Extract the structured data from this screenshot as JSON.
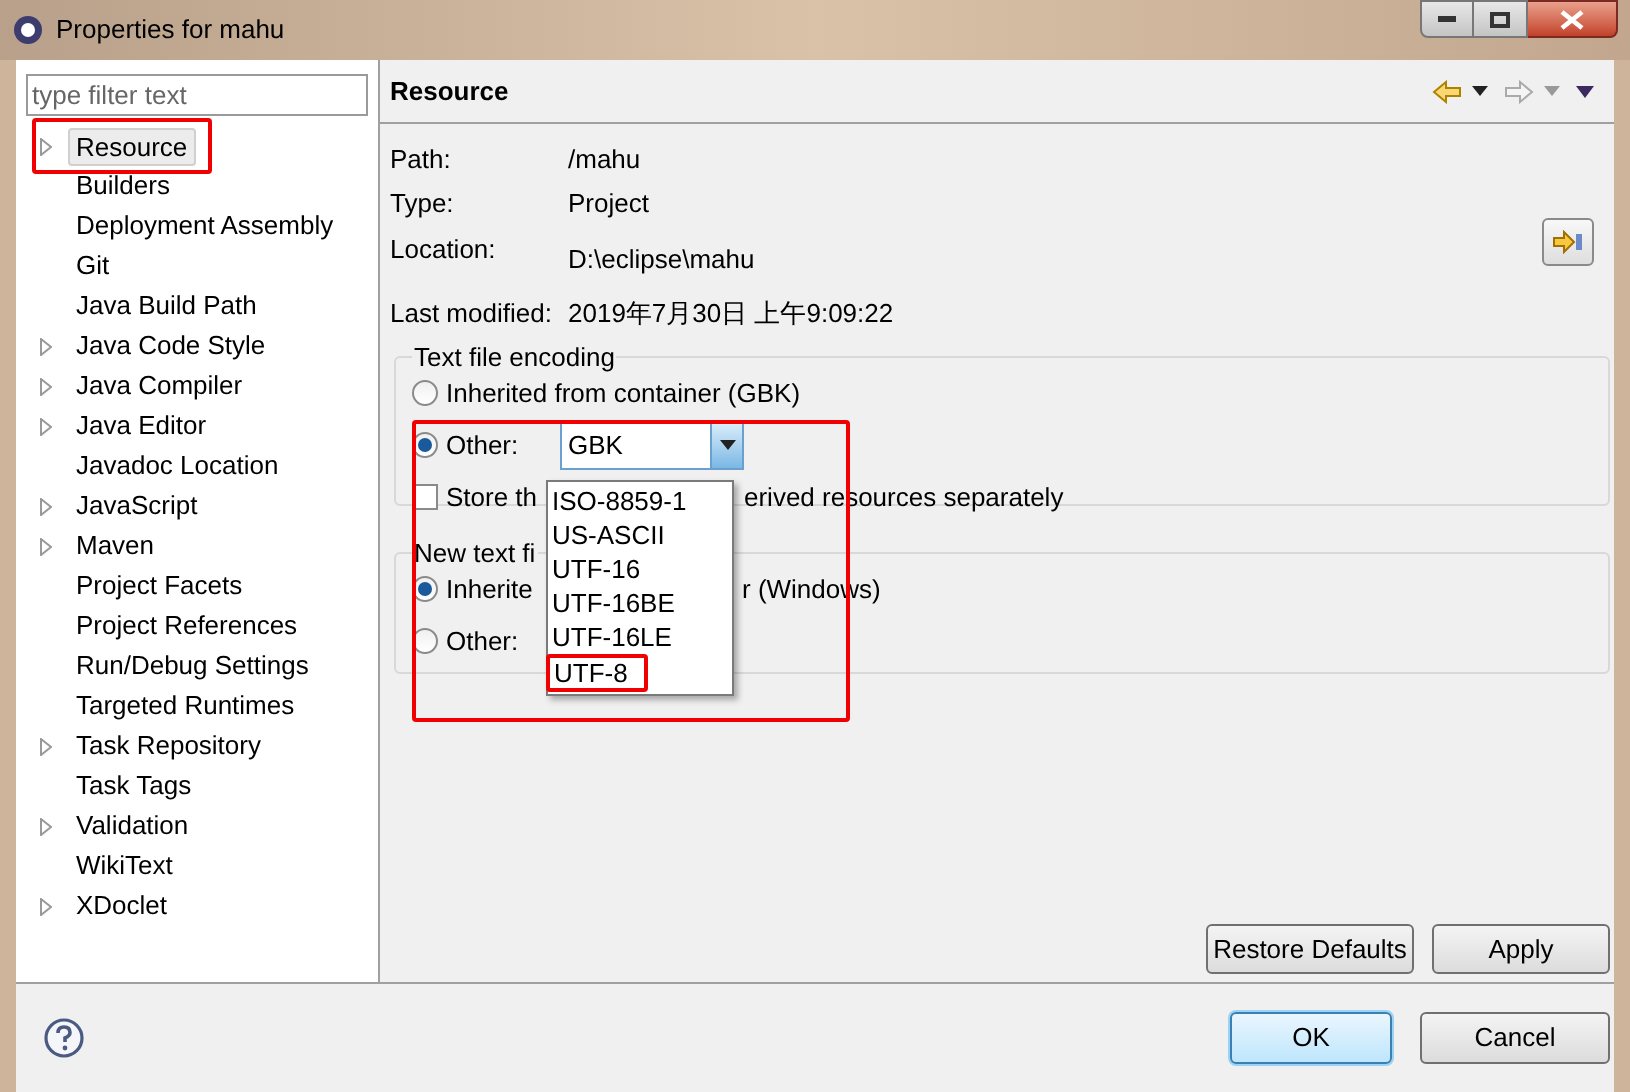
{
  "window": {
    "title": "Properties for mahu"
  },
  "filter": {
    "placeholder": "type filter text"
  },
  "tree": [
    {
      "label": "Resource",
      "expandable": true,
      "selected": true
    },
    {
      "label": "Builders",
      "expandable": false,
      "selected": false
    },
    {
      "label": "Deployment Assembly",
      "expandable": false,
      "selected": false
    },
    {
      "label": "Git",
      "expandable": false,
      "selected": false
    },
    {
      "label": "Java Build Path",
      "expandable": false,
      "selected": false
    },
    {
      "label": "Java Code Style",
      "expandable": true,
      "selected": false
    },
    {
      "label": "Java Compiler",
      "expandable": true,
      "selected": false
    },
    {
      "label": "Java Editor",
      "expandable": true,
      "selected": false
    },
    {
      "label": "Javadoc Location",
      "expandable": false,
      "selected": false
    },
    {
      "label": "JavaScript",
      "expandable": true,
      "selected": false
    },
    {
      "label": "Maven",
      "expandable": true,
      "selected": false
    },
    {
      "label": "Project Facets",
      "expandable": false,
      "selected": false
    },
    {
      "label": "Project References",
      "expandable": false,
      "selected": false
    },
    {
      "label": "Run/Debug Settings",
      "expandable": false,
      "selected": false
    },
    {
      "label": "Targeted Runtimes",
      "expandable": false,
      "selected": false
    },
    {
      "label": "Task Repository",
      "expandable": true,
      "selected": false
    },
    {
      "label": "Task Tags",
      "expandable": false,
      "selected": false
    },
    {
      "label": "Validation",
      "expandable": true,
      "selected": false
    },
    {
      "label": "WikiText",
      "expandable": false,
      "selected": false
    },
    {
      "label": "XDoclet",
      "expandable": true,
      "selected": false
    }
  ],
  "page": {
    "title": "Resource",
    "properties": [
      {
        "label": "Path:",
        "value": "/mahu"
      },
      {
        "label": "Type:",
        "value": "Project"
      },
      {
        "label": "Location:",
        "value": "D:\\eclipse\\mahu"
      },
      {
        "label": "Last modified:",
        "value": "2019年7月30日 上午9:09:22"
      }
    ]
  },
  "text_file_encoding": {
    "title": "Text file encoding",
    "inherited": {
      "label": "Inherited from container (GBK)",
      "selected": false
    },
    "other": {
      "label": "Other:",
      "selected": true,
      "value": "GBK"
    },
    "store": {
      "label_start": "Store th",
      "label_end": "erived resources separately",
      "checked": false
    }
  },
  "new_text_file": {
    "title": "New text fi",
    "inherited": {
      "label_start": "Inherite",
      "label_end": "r (Windows)",
      "selected": true
    },
    "other": {
      "label": "Other:",
      "selected": false
    }
  },
  "encoding_list": [
    {
      "label": "ISO-8859-1",
      "highlighted": false
    },
    {
      "label": "US-ASCII",
      "highlighted": false
    },
    {
      "label": "UTF-16",
      "highlighted": false
    },
    {
      "label": "UTF-16BE",
      "highlighted": false
    },
    {
      "label": "UTF-16LE",
      "highlighted": false
    },
    {
      "label": "UTF-8",
      "highlighted": true
    }
  ],
  "buttons": {
    "restore": "Restore Defaults",
    "apply": "Apply",
    "ok": "OK",
    "cancel": "Cancel"
  }
}
